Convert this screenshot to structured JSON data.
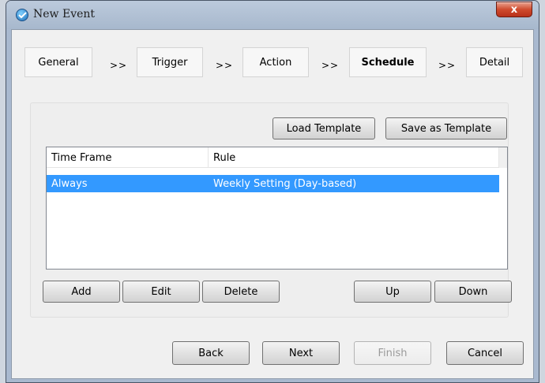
{
  "window": {
    "title": "New Event",
    "close_glyph": "x"
  },
  "steps": [
    {
      "label": "General"
    },
    {
      "label": "Trigger"
    },
    {
      "label": "Action"
    },
    {
      "label": "Schedule"
    },
    {
      "label": "Detail"
    }
  ],
  "step_separator": ">>",
  "active_step": "Schedule",
  "template_buttons": {
    "load": "Load Template",
    "save": "Save as Template"
  },
  "table": {
    "columns": [
      "Time Frame",
      "Rule"
    ],
    "rows": [
      {
        "time_frame": "Always",
        "rule": "Weekly Setting (Day-based)",
        "selected": true
      }
    ]
  },
  "row_buttons": {
    "add": "Add",
    "edit": "Edit",
    "delete": "Delete",
    "up": "Up",
    "down": "Down"
  },
  "nav_buttons": {
    "back": "Back",
    "next": "Next",
    "finish": "Finish",
    "cancel": "Cancel",
    "finish_enabled": false
  },
  "colors": {
    "selection": "#3399ff",
    "close_button": "#c7432a",
    "titlebar": "#a9b9cf"
  },
  "icons": {
    "app": "shield-check-icon",
    "close": "close-icon"
  }
}
